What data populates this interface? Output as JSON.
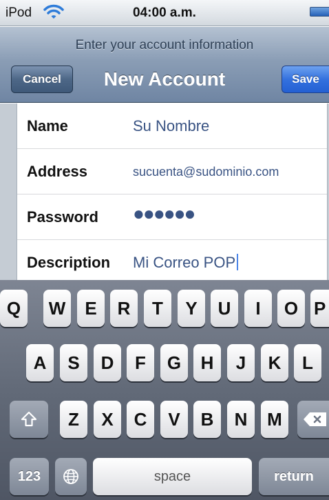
{
  "status_bar": {
    "carrier": "iPod",
    "time": "04:00 a.m."
  },
  "nav": {
    "prompt": "Enter your account information",
    "title": "New Account",
    "cancel_label": "Cancel",
    "save_label": "Save"
  },
  "form": {
    "rows": [
      {
        "label": "Name",
        "value": "Su Nombre"
      },
      {
        "label": "Address",
        "value": "sucuenta@sudominio.com"
      },
      {
        "label": "Password",
        "value": "●●●●●●"
      },
      {
        "label": "Description",
        "value": "Mi Correo POP"
      }
    ]
  },
  "keyboard": {
    "row1": [
      "Q",
      "W",
      "E",
      "R",
      "T",
      "Y",
      "U",
      "I",
      "O",
      "P"
    ],
    "row2": [
      "A",
      "S",
      "D",
      "F",
      "G",
      "H",
      "J",
      "K",
      "L"
    ],
    "row3": [
      "Z",
      "X",
      "C",
      "V",
      "B",
      "N",
      "M"
    ],
    "numbers_label": "123",
    "space_label": "space",
    "return_label": "return"
  },
  "colors": {
    "accent_blue": "#2460d3",
    "nav_bar": "#6f85a3",
    "field_value": "#395383"
  },
  "icons": {
    "wifi": "wifi-icon",
    "battery": "battery-icon",
    "shift": "shift-icon",
    "delete": "delete-icon",
    "globe": "globe-icon"
  }
}
